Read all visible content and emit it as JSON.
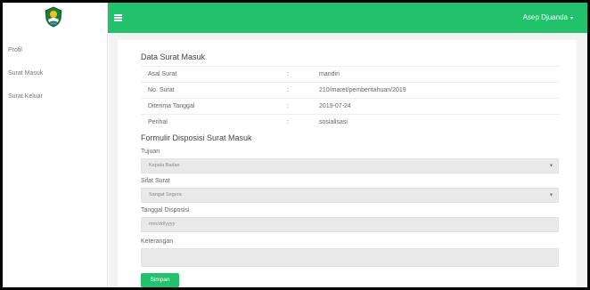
{
  "header": {
    "user_name": "Asep Djuanda",
    "caret": "▾"
  },
  "sidebar": {
    "items": [
      {
        "label": "Profil"
      },
      {
        "label": "Surat Masuk"
      },
      {
        "label": "Surat Keluar"
      }
    ]
  },
  "data_surat": {
    "title": "Data Surat Masuk",
    "separator": ":",
    "rows": [
      {
        "label": "Asal Surat",
        "value": "mandiri"
      },
      {
        "label": "No. Surat",
        "value": "210/maret/pemberitahuan/2019"
      },
      {
        "label": "Diterima Tanggal",
        "value": "2019-07-24"
      },
      {
        "label": "Perihal",
        "value": "sosialisasi"
      }
    ]
  },
  "form": {
    "title": "Formulir Disposisi Surat Masuk",
    "tujuan": {
      "label": "Tujuan",
      "value": "Kepala Badan"
    },
    "sifat": {
      "label": "Sifat Surat",
      "value": "Sangat Segera"
    },
    "tanggal": {
      "label": "Tanggal Disposisi",
      "placeholder": "mm/dd/yyyy"
    },
    "keterangan": {
      "label": "Keterangan",
      "value": ""
    },
    "submit_label": "Simpan",
    "select_arrow": "▼"
  },
  "colors": {
    "accent": "#22c16b",
    "content_bg": "#f3f3f3"
  },
  "icons": {
    "logo": "west-java-emblem-icon",
    "menu": "hamburger-menu-icon"
  }
}
